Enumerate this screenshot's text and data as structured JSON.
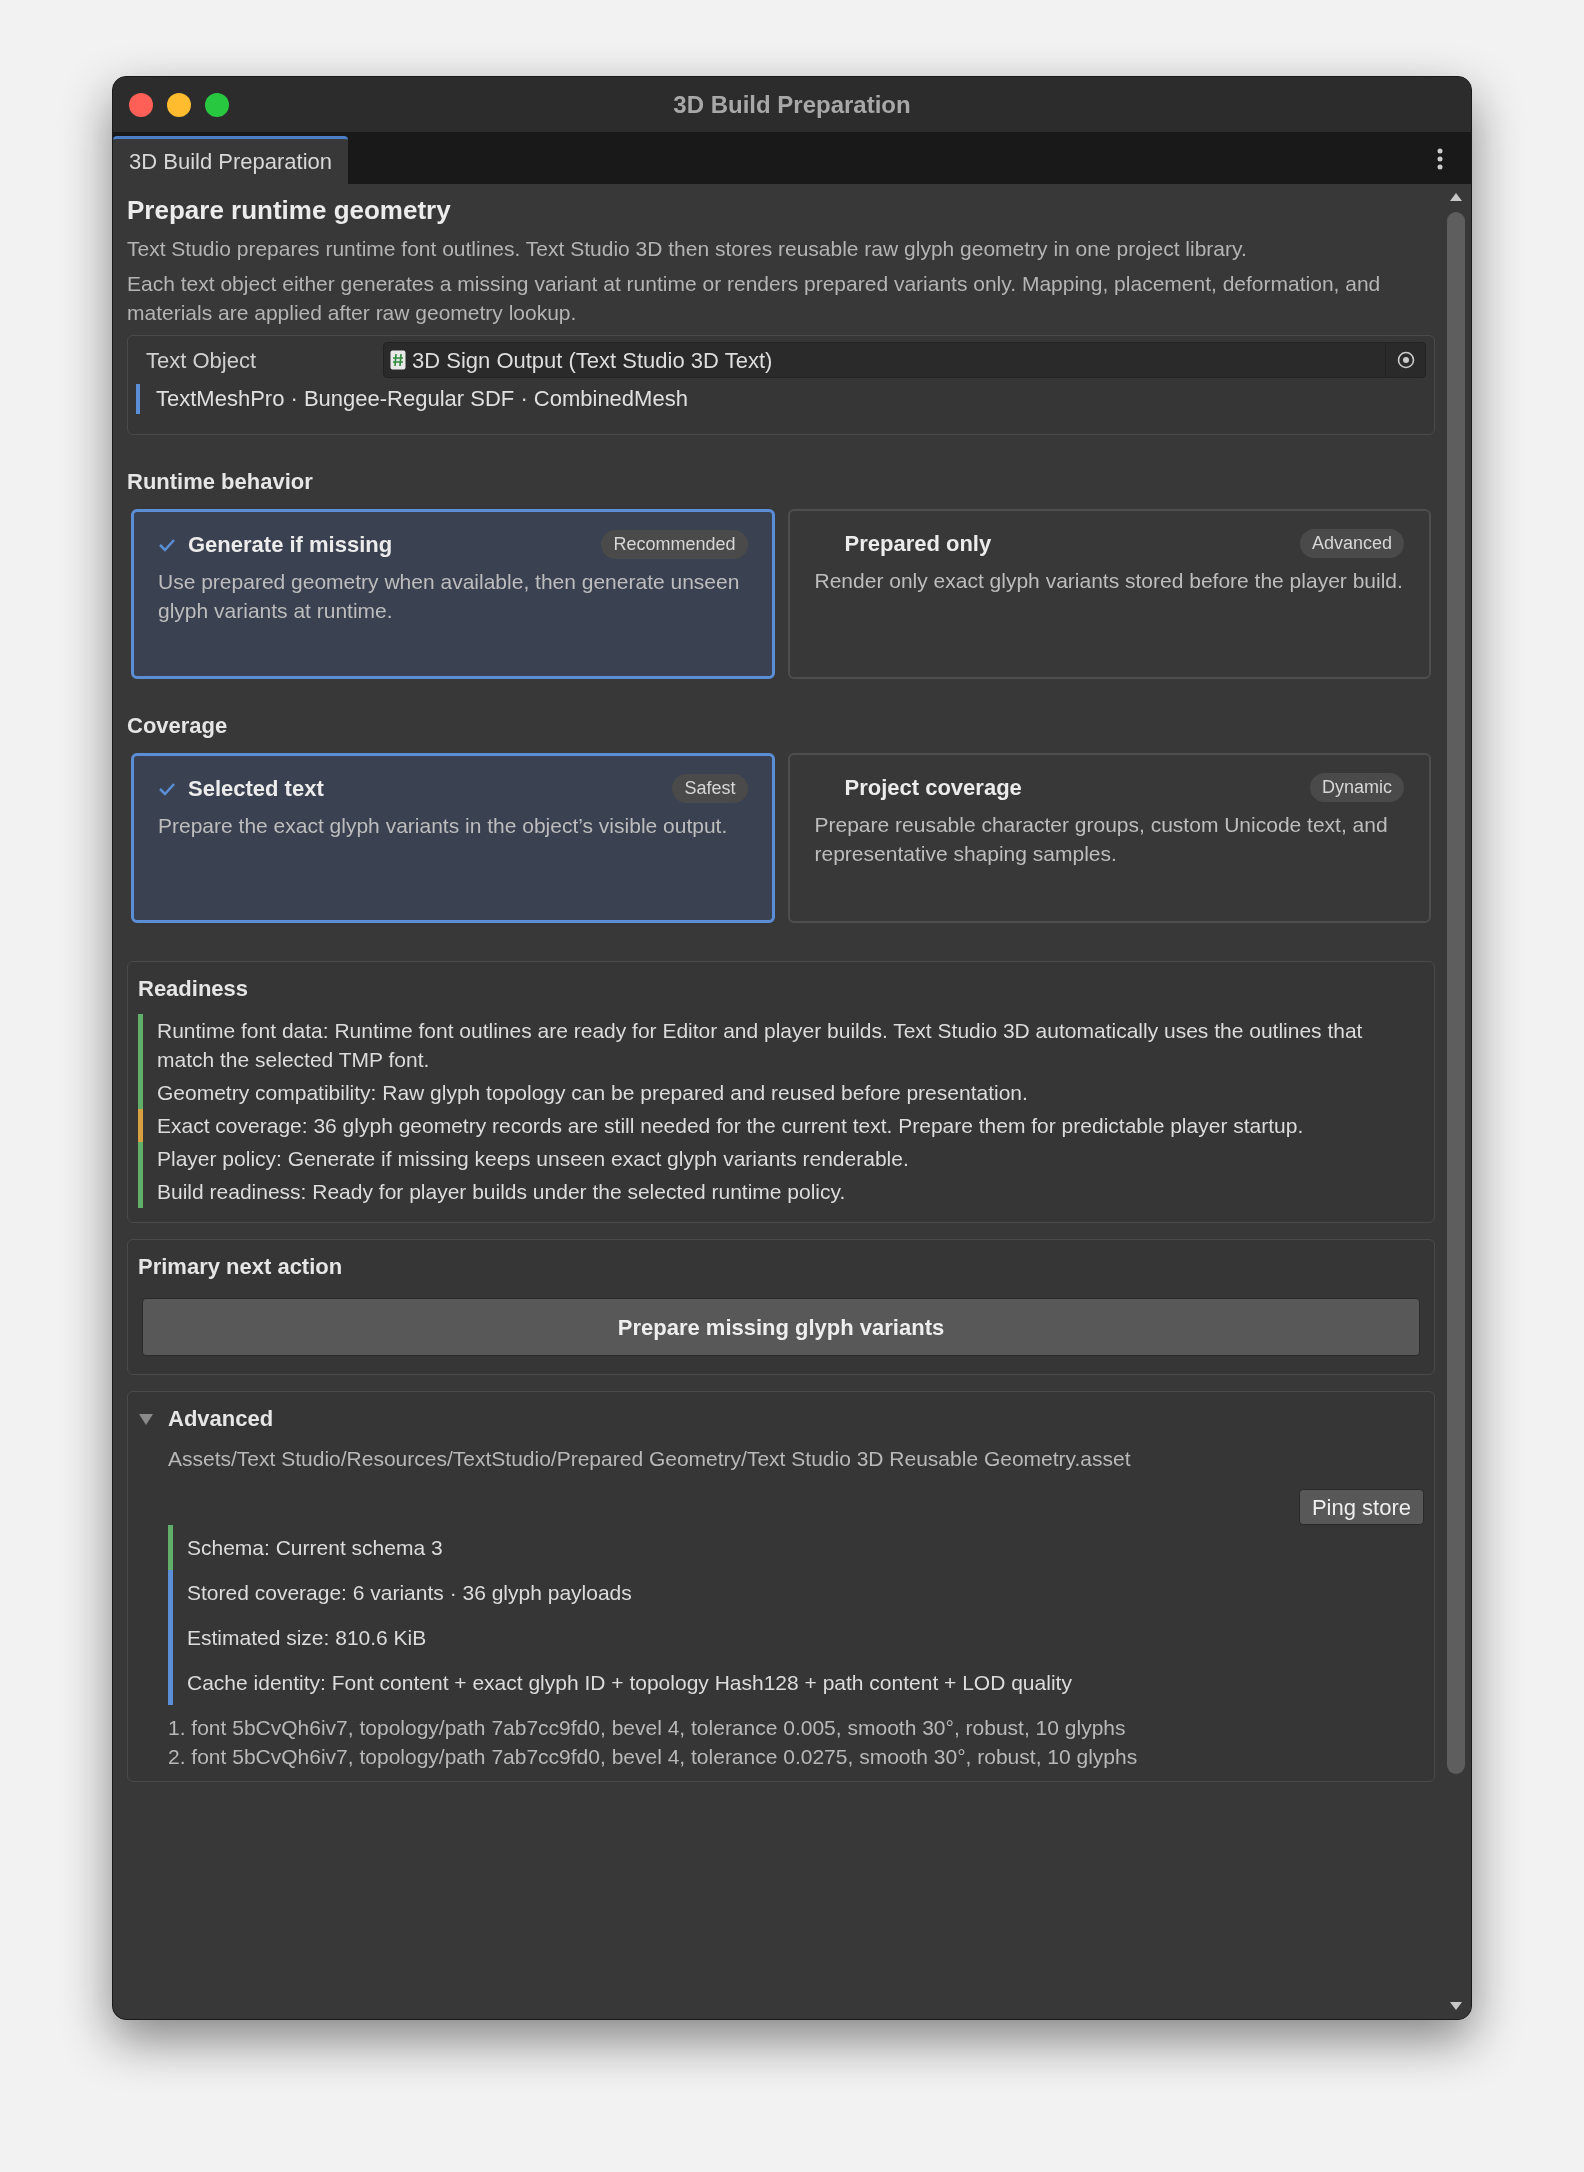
{
  "window": {
    "title": "3D Build Preparation"
  },
  "tabs": [
    {
      "label": "3D Build Preparation",
      "selected": true
    }
  ],
  "header": {
    "title": "Prepare runtime geometry",
    "paragraphs": [
      "Text Studio prepares runtime font outlines. Text Studio 3D then stores reusable raw glyph geometry in one project library.",
      "Each text object either generates a missing variant at runtime or renders prepared variants only. Mapping, placement, deformation, and materials are applied after raw geometry lookup."
    ]
  },
  "text_object": {
    "label": "Text Object",
    "value": "3D Sign Output (Text Studio 3D Text)",
    "info": "TextMeshPro · Bungee-Regular SDF · CombinedMesh"
  },
  "sections": [
    {
      "title": "Runtime behavior",
      "options": [
        {
          "title": "Generate if missing",
          "badge": "Recommended",
          "description": "Use prepared geometry when available, then generate unseen glyph variants at runtime.",
          "selected": true
        },
        {
          "title": "Prepared only",
          "badge": "Advanced",
          "description": "Render only exact glyph variants stored before the player build.",
          "selected": false
        }
      ]
    },
    {
      "title": "Coverage",
      "options": [
        {
          "title": "Selected text",
          "badge": "Safest",
          "description": "Prepare the exact glyph variants in the object’s visible output.",
          "selected": true
        },
        {
          "title": "Project coverage",
          "badge": "Dynamic",
          "description": "Prepare reusable character groups, custom Unicode text, and representative shaping samples.",
          "selected": false
        }
      ]
    }
  ],
  "readiness": {
    "title": "Readiness",
    "items": [
      {
        "text": "Runtime font data: Runtime font outlines are ready for Editor and player builds. Text Studio 3D automatically uses the outlines that match the selected TMP font.",
        "color": "#5fae6a"
      },
      {
        "text": "Geometry compatibility: Raw glyph topology can be prepared and reused before presentation.",
        "color": "#5fae6a"
      },
      {
        "text": "Exact coverage: 36 glyph geometry records are still needed for the current text. Prepare them for predictable player startup.",
        "color": "#d9a03f"
      },
      {
        "text": "Player policy: Generate if missing keeps unseen exact glyph variants renderable.",
        "color": "#5fae6a"
      },
      {
        "text": "Build readiness: Ready for player builds under the selected runtime policy.",
        "color": "#5fae6a"
      }
    ]
  },
  "primary": {
    "title": "Primary next action",
    "button": "Prepare missing glyph variants"
  },
  "advanced": {
    "title": "Advanced",
    "expanded": true,
    "path": "Assets/Text Studio/Resources/TextStudio/Prepared Geometry/Text Studio 3D Reusable Geometry.asset",
    "button": "Ping store",
    "items": [
      {
        "text": "Schema: Current schema 3",
        "color": "#5fae6a"
      },
      {
        "text": "Stored coverage: 6 variants · 36 glyph payloads",
        "color": "#5a8fd8"
      },
      {
        "text": "Estimated size: 810.6 KiB",
        "color": "#5a8fd8"
      },
      {
        "text": "Cache identity: Font content + exact glyph ID + topology Hash128 + path content + LOD quality",
        "color": "#5a8fd8"
      }
    ],
    "records": [
      "1. font 5bCvQh6iv7, topology/path 7ab7cc9fd0, bevel 4, tolerance 0.005, smooth 30°, robust, 10 glyphs",
      "2. font 5bCvQh6iv7, topology/path 7ab7cc9fd0, bevel 4, tolerance 0.0275, smooth 30°, robust, 10 glyphs"
    ]
  }
}
